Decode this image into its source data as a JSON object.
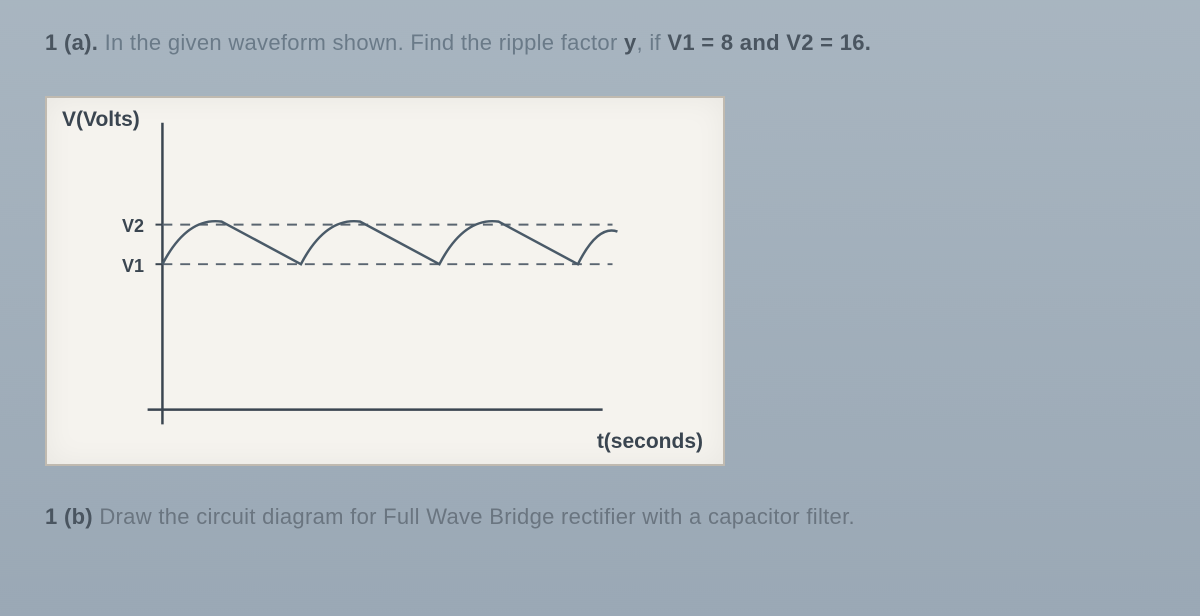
{
  "question_a": {
    "prefix": "1 (a).",
    "body_part1": " In the given waveform shown. Find the ripple factor ",
    "bold_y": "y",
    "body_part2": ", if ",
    "bold_cond": "V1 = 8 and V2 = 16."
  },
  "question_b": {
    "prefix": "1 (b)",
    "body": " Draw the circuit diagram for Full Wave Bridge rectifier with a capacitor filter."
  },
  "chart": {
    "y_label": "V(Volts)",
    "x_label": "t(seconds)",
    "tick_v1": "V1",
    "tick_v2": "V2"
  },
  "chart_data": {
    "type": "line",
    "title": "",
    "xlabel": "t(seconds)",
    "ylabel": "V(Volts)",
    "y_ticks": [
      "V1",
      "V2"
    ],
    "y_tick_values": [
      8,
      16
    ],
    "ylim": [
      0,
      20
    ],
    "description": "Rectified waveform with capacitor filter ripple oscillating between V1=8 (trough) and V2=16 (peak). Three full ripple cycles shown. Each cycle: rapid capacitor charge to V2 peak, then exponential discharge to V1.",
    "series": [
      {
        "name": "ripple-waveform",
        "x": [
          0,
          0.5,
          1,
          1.5,
          2,
          2.5,
          3,
          3.5
        ],
        "y": [
          8,
          16,
          8,
          16,
          8,
          16,
          8,
          16
        ]
      }
    ],
    "guide_lines": [
      {
        "name": "V2-level",
        "y": 16,
        "style": "dashed"
      },
      {
        "name": "V1-level",
        "y": 8,
        "style": "dashed"
      }
    ]
  }
}
